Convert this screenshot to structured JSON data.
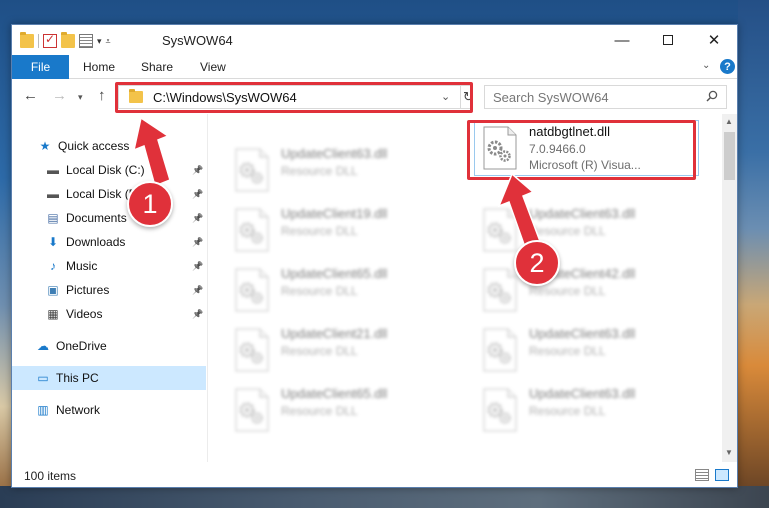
{
  "window": {
    "title": "SysWOW64"
  },
  "ribbon": {
    "file": "File",
    "home": "Home",
    "share": "Share",
    "view": "View"
  },
  "address": {
    "path": "C:\\Windows\\SysWOW64"
  },
  "search": {
    "placeholder": "Search SysWOW64"
  },
  "nav": {
    "items": [
      {
        "label": "Quick access",
        "icon": "star-icon"
      },
      {
        "label": "Local Disk (C:)",
        "icon": "drive-icon",
        "pinned": true
      },
      {
        "label": "Local Disk (D:)",
        "icon": "drive-icon",
        "pinned": true
      },
      {
        "label": "Documents",
        "icon": "documents-icon",
        "pinned": true
      },
      {
        "label": "Downloads",
        "icon": "downloads-icon",
        "pinned": true
      },
      {
        "label": "Music",
        "icon": "music-icon",
        "pinned": true
      },
      {
        "label": "Pictures",
        "icon": "pictures-icon",
        "pinned": true
      },
      {
        "label": "Videos",
        "icon": "videos-icon",
        "pinned": true
      },
      {
        "label": "OneDrive",
        "icon": "cloud-icon"
      },
      {
        "label": "This PC",
        "icon": "monitor-icon",
        "selected": true
      },
      {
        "label": "Network",
        "icon": "network-icon"
      }
    ]
  },
  "files": {
    "left": [
      {
        "name": "UpdateClient63.dll",
        "type": "Resource DLL"
      },
      {
        "name": "UpdateClient19.dll",
        "type": "Resource DLL"
      },
      {
        "name": "UpdateClient65.dll",
        "type": "Resource DLL"
      },
      {
        "name": "UpdateClient21.dll",
        "type": "Resource DLL"
      },
      {
        "name": "UpdateClient65.dll",
        "type": "Resource DLL"
      }
    ],
    "highlighted": {
      "name": "natdbgtlnet.dll",
      "version": "7.0.9466.0",
      "company": "Microsoft (R) Visua..."
    },
    "right": [
      {
        "name": "UpdateClient63.dll",
        "type": "Resource DLL"
      },
      {
        "name": "UpdateClient42.dll",
        "type": "Resource DLL"
      },
      {
        "name": "UpdateClient63.dll",
        "type": "Resource DLL"
      },
      {
        "name": "UpdateClient63.dll",
        "type": "Resource DLL"
      }
    ]
  },
  "status": {
    "count": "100 items"
  },
  "annotations": {
    "step1": "1",
    "step2": "2",
    "color": "#e0313a"
  }
}
